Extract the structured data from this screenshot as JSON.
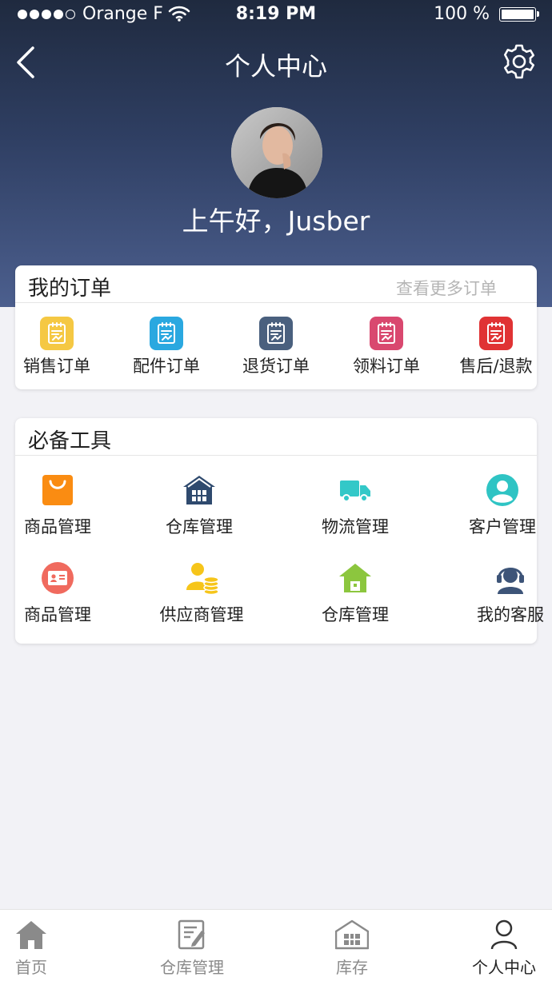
{
  "status_bar": {
    "carrier": "Orange F",
    "time": "8:19 PM",
    "battery": "100 %"
  },
  "nav": {
    "title": "个人中心",
    "back_icon": "chevron-left-icon",
    "settings_icon": "gear-icon"
  },
  "profile": {
    "greeting": "上午好，Jusber"
  },
  "orders": {
    "title": "我的订单",
    "more": "查看更多订单",
    "items": [
      {
        "label": "销售订单",
        "color": "#f5c843"
      },
      {
        "label": "配件订单",
        "color": "#2aa8e0"
      },
      {
        "label": "退货订单",
        "color": "#4a607e"
      },
      {
        "label": "领料订单",
        "color": "#d9486f"
      },
      {
        "label": "售后/退款",
        "color": "#e03334"
      }
    ]
  },
  "tools": {
    "title": "必备工具",
    "items": [
      {
        "label": "商品管理",
        "icon": "shopping-bag-icon",
        "color": "#fa8c12"
      },
      {
        "label": "仓库管理",
        "icon": "warehouse-icon",
        "color": "#2f4a6e"
      },
      {
        "label": "物流管理",
        "icon": "truck-icon",
        "color": "#33c8c8"
      },
      {
        "label": "客户管理",
        "icon": "customer-icon",
        "color": "#2fc4c4"
      },
      {
        "label": "商品管理",
        "icon": "id-card-icon",
        "color": "#f06a5e"
      },
      {
        "label": "供应商管理",
        "icon": "supplier-coins-icon",
        "color": "#f6c51a"
      },
      {
        "label": "仓库管理",
        "icon": "green-house-icon",
        "color": "#8cc63e"
      },
      {
        "label": "我的客服",
        "icon": "headset-icon",
        "color": "#3d5478"
      }
    ]
  },
  "tabbar": {
    "items": [
      {
        "label": "首页",
        "icon": "home-icon"
      },
      {
        "label": "仓库管理",
        "icon": "edit-document-icon"
      },
      {
        "label": "库存",
        "icon": "warehouse-icon"
      },
      {
        "label": "个人中心",
        "icon": "user-icon"
      }
    ],
    "active_index": 3
  }
}
